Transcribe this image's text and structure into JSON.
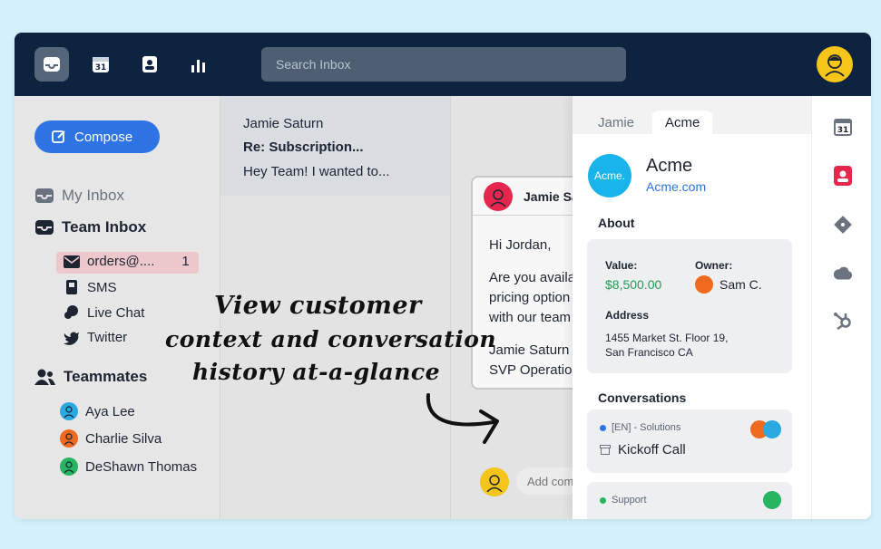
{
  "search": {
    "placeholder": "Search Inbox"
  },
  "sidebar": {
    "compose_label": "Compose",
    "my_inbox": "My Inbox",
    "team_inbox": "Team Inbox",
    "channels": [
      {
        "label": "orders@....",
        "count": "1"
      },
      {
        "label": "SMS"
      },
      {
        "label": "Live Chat"
      },
      {
        "label": "Twitter"
      }
    ],
    "teammates_title": "Teammates",
    "teammates": [
      {
        "name": "Aya Lee",
        "color": "#2aa9e0"
      },
      {
        "name": "Charlie Silva",
        "color": "#ef6a1f"
      },
      {
        "name": "DeShawn Thomas",
        "color": "#27b561"
      }
    ]
  },
  "message_list": {
    "selected": {
      "from": "Jamie Saturn",
      "subject": "Re: Subscription...",
      "preview": "Hey Team! I wanted to..."
    }
  },
  "conversation": {
    "sender": "Jamie Sa",
    "lines": [
      "Hi Jordan,",
      "Are you availa",
      "pricing option",
      "with our team",
      "Jamie Saturn",
      "SVP Operatio"
    ],
    "comment_placeholder": "Add com"
  },
  "context": {
    "tabs": [
      "Jamie",
      "Acme"
    ],
    "company": {
      "logo_text": "Acme.",
      "name": "Acme",
      "domain": "Acme.com"
    },
    "about_title": "About",
    "value_label": "Value:",
    "value": "$8,500.00",
    "owner_label": "Owner:",
    "owner": "Sam C.",
    "address_label": "Address",
    "address_line1": "1455 Market St. Floor 19,",
    "address_line2": "San Francisco CA",
    "conversations_title": "Conversations",
    "conversations": [
      {
        "tag": "[EN] - Solutions",
        "title": "Kickoff Call",
        "dot_color": "#2f74e5"
      },
      {
        "tag": "Support",
        "dot_color": "#27b561"
      }
    ]
  },
  "rail": {
    "calendar_day": "31"
  },
  "annotation": {
    "line1": "View customer",
    "line2": "context and conversation",
    "line3": "history at-a-glance"
  },
  "colors": {
    "topbar": "#0e2340",
    "accent": "#2f74e5",
    "value_green": "#1f9d55",
    "contact_red": "#e5264d"
  }
}
